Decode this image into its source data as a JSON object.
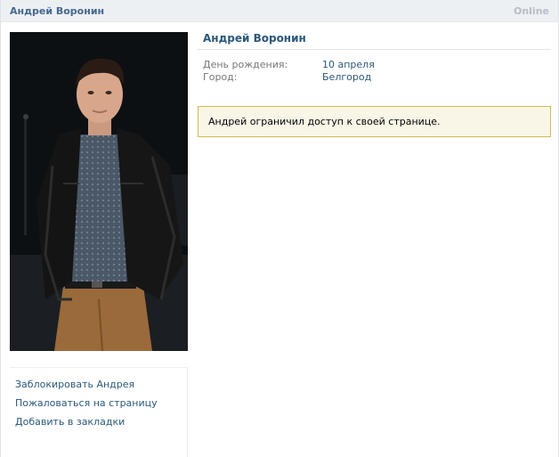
{
  "header": {
    "title": "Андрей Воронин",
    "status": "Online"
  },
  "profile": {
    "name": "Андрей Воронин",
    "fields": [
      {
        "label": "День рождения:",
        "value": "10 апреля"
      },
      {
        "label": "Город:",
        "value": "Белгород"
      }
    ],
    "notice": "Андрей ограничил доступ к своей странице."
  },
  "actions": [
    {
      "label": "Заблокировать Андрея"
    },
    {
      "label": "Пожаловаться на страницу"
    },
    {
      "label": "Добавить в закладки"
    }
  ],
  "colors": {
    "link": "#2b587a",
    "header_bg": "#edf0f3",
    "notice_bg": "#f9f6e7",
    "notice_border": "#d4bc4c"
  }
}
